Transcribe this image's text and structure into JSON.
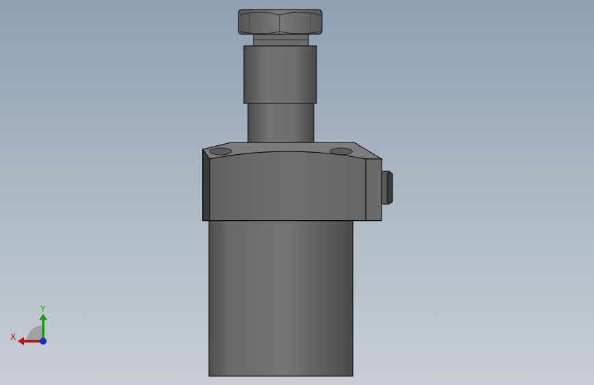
{
  "viewport": {
    "background_top": "#8fa0b3",
    "background_bottom": "#c9ced3"
  },
  "model": {
    "body_color": "#6e6e6e",
    "edge_color": "#111111"
  },
  "triad": {
    "x_label": "X",
    "y_label": "Y",
    "x_color": "#b01818",
    "y_color": "#17a317",
    "z_color": "#1a2fcc"
  }
}
